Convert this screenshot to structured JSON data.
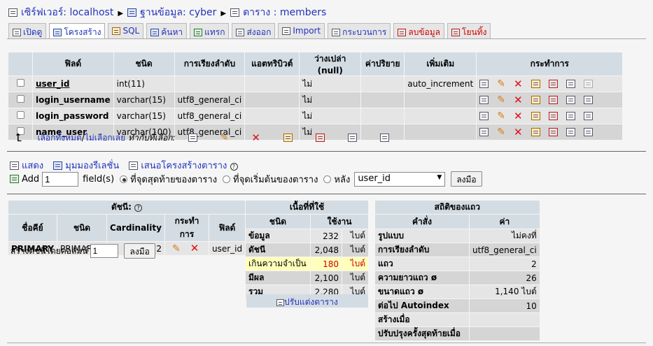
{
  "breadcrumb": {
    "server": "เซิร์ฟเวอร์: localhost",
    "database": "ฐานข้อมูล: cyber",
    "table": "ตาราง : members"
  },
  "tabs": [
    {
      "label": "เปิดดู",
      "icon": "browse-icon"
    },
    {
      "label": "โครงสร้าง",
      "icon": "structure-icon"
    },
    {
      "label": "SQL",
      "icon": "sql-icon"
    },
    {
      "label": "ค้นหา",
      "icon": "search-icon"
    },
    {
      "label": "แทรก",
      "icon": "insert-icon"
    },
    {
      "label": "ส่งออก",
      "icon": "export-icon"
    },
    {
      "label": "Import",
      "icon": "import-icon"
    },
    {
      "label": "กระบวนการ",
      "icon": "operations-icon"
    },
    {
      "label": "ลบข้อมูล",
      "icon": "empty-icon"
    },
    {
      "label": "โยนทิ้ง",
      "icon": "drop-icon"
    }
  ],
  "structure": {
    "headers": [
      "ฟิลด์",
      "ชนิด",
      "การเรียงลำดับ",
      "แอตทริบิวต์",
      "ว่างเปล่า (null)",
      "ค่าปริยาย",
      "เพิ่มเติม",
      "กระทำการ"
    ],
    "rows": [
      {
        "field": "user_id",
        "type": "int(11)",
        "collation": "",
        "attributes": "",
        "null": "ไม่",
        "default": "",
        "extra": "auto_increment"
      },
      {
        "field": "login_username",
        "type": "varchar(15)",
        "collation": "utf8_general_ci",
        "attributes": "",
        "null": "ไม่",
        "default": "",
        "extra": ""
      },
      {
        "field": "login_password",
        "type": "varchar(15)",
        "collation": "utf8_general_ci",
        "attributes": "",
        "null": "ไม่",
        "default": "",
        "extra": ""
      },
      {
        "field": "name_user",
        "type": "varchar(100)",
        "collation": "utf8_general_ci",
        "attributes": "",
        "null": "ไม่",
        "default": "",
        "extra": ""
      }
    ]
  },
  "select_row": {
    "check_all": "เลือกทั้งหมด",
    "separator": " / ",
    "uncheck_all": "ไม่เลือกเลย",
    "with_selected": "ทำกับที่เลือก:"
  },
  "links": {
    "print": "แสดง",
    "relation": "มุมมองรีเลชั่น",
    "propose": "เสนอโครงสร้างตาราง"
  },
  "add_field": {
    "add_label": "Add",
    "count": "1",
    "fields_label": "field(s)",
    "at_end": "ที่จุดสุดท้ายของตาราง",
    "at_begin": "ที่จุดเริ่มต้นของตาราง",
    "after": "หลัง",
    "after_field": "user_id",
    "go": "ลงมือ"
  },
  "indexes": {
    "caption": "ดัชนี:",
    "headers": [
      "ชื่อคีย์",
      "ชนิด",
      "Cardinality",
      "กระทำการ",
      "ฟิลด์"
    ],
    "rows": [
      {
        "keyname": "PRIMARY",
        "type": "PRIMARY",
        "cardinality": "2",
        "field": "user_id"
      }
    ],
    "create_label": "สร้างดัชนีโดยคอลัมน์",
    "create_count": "1",
    "go": "ลงมือ"
  },
  "space_usage": {
    "caption": "เนื้อที่ที่ใช้",
    "headers": [
      "ชนิด",
      "ใช้งาน"
    ],
    "rows": [
      {
        "label": "ข้อมูล",
        "value": "232",
        "unit": "ไบต์"
      },
      {
        "label": "ดัชนี",
        "value": "2,048",
        "unit": "ไบต์"
      },
      {
        "label": "เกินความจำเป็น",
        "value": "180",
        "unit": "ไบต์"
      },
      {
        "label": "มีผล",
        "value": "2,100",
        "unit": "ไบต์"
      },
      {
        "label": "รวม",
        "value": "2,280",
        "unit": "ไบต์"
      }
    ],
    "optimize": "ปรับแต่งตาราง"
  },
  "row_stats": {
    "caption": "สถิติของแถว",
    "headers": [
      "คำสั่ง",
      "ค่า"
    ],
    "rows": [
      {
        "label": "รูปแบบ",
        "value": "ไม่คงที่"
      },
      {
        "label": "การเรียงลำดับ",
        "value": "utf8_general_ci"
      },
      {
        "label": "แถว",
        "value": "2"
      },
      {
        "label": "ความยาวแถว ø",
        "value": "26"
      },
      {
        "label": "ขนาดแถว ø",
        "value": "1,140 ไบต์"
      },
      {
        "label": "ต่อไป Autoindex",
        "value": "10"
      },
      {
        "label": "สร้างเมื่อ",
        "value": ""
      },
      {
        "label": "ปรับปรุงครั้งสุดท้ายเมื่อ",
        "value": ""
      }
    ]
  }
}
